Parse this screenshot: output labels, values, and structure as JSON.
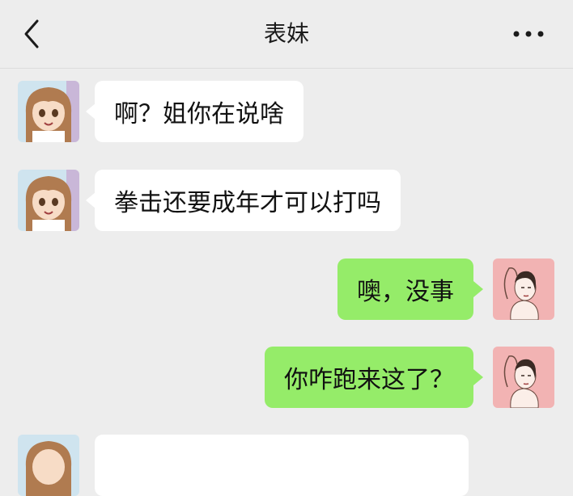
{
  "header": {
    "back_icon": "chevron-left-icon",
    "title": "表妹",
    "more_icon": "ellipsis-icon"
  },
  "messages": [
    {
      "side": "left",
      "text": "啊？姐你在说啥"
    },
    {
      "side": "left",
      "text": "拳击还要成年才可以打吗"
    },
    {
      "side": "right",
      "text": "噢，没事"
    },
    {
      "side": "right",
      "text": "你咋跑来这了？"
    },
    {
      "side": "left",
      "text": ""
    }
  ],
  "colors": {
    "background": "#ededed",
    "bubble_left": "#ffffff",
    "bubble_right": "#95ec69"
  }
}
